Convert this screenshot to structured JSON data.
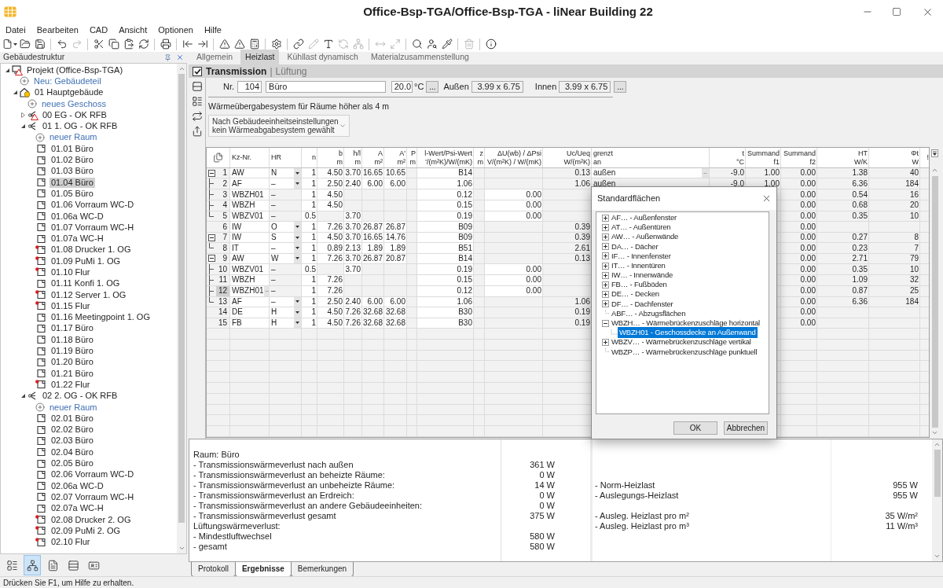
{
  "window": {
    "title": "Office-Bsp-TGA/Office-Bsp-TGA - liNear Building 22"
  },
  "menu": [
    "Datei",
    "Bearbeiten",
    "CAD",
    "Ansicht",
    "Optionen",
    "Hilfe"
  ],
  "toolbar": [
    {
      "kind": "new",
      "disabled": false
    },
    {
      "kind": "open",
      "disabled": false
    },
    {
      "kind": "save",
      "disabled": false
    },
    {
      "kind": "separator"
    },
    {
      "kind": "undo",
      "disabled": false
    },
    {
      "kind": "redo",
      "disabled": true
    },
    {
      "kind": "separator"
    },
    {
      "kind": "cut",
      "disabled": false
    },
    {
      "kind": "copy",
      "disabled": false
    },
    {
      "kind": "paste",
      "disabled": false
    },
    {
      "kind": "sync",
      "disabled": false
    },
    {
      "kind": "separator"
    },
    {
      "kind": "print",
      "disabled": false
    },
    {
      "kind": "separator"
    },
    {
      "kind": "import",
      "disabled": false
    },
    {
      "kind": "export",
      "disabled": false
    },
    {
      "kind": "separator"
    },
    {
      "kind": "warning",
      "disabled": false
    },
    {
      "kind": "warning",
      "disabled": false
    },
    {
      "kind": "calc",
      "disabled": false
    },
    {
      "kind": "separator"
    },
    {
      "kind": "settings",
      "disabled": false
    },
    {
      "kind": "separator"
    },
    {
      "kind": "link",
      "disabled": false
    },
    {
      "kind": "pencil",
      "disabled": true
    },
    {
      "kind": "text",
      "disabled": false
    },
    {
      "kind": "rotate",
      "disabled": true
    },
    {
      "kind": "tree",
      "disabled": true
    },
    {
      "kind": "separator"
    },
    {
      "kind": "measure",
      "disabled": true
    },
    {
      "kind": "resize",
      "disabled": true
    },
    {
      "kind": "separator"
    },
    {
      "kind": "search",
      "disabled": false
    },
    {
      "kind": "find",
      "disabled": false
    },
    {
      "kind": "pick",
      "disabled": false
    },
    {
      "kind": "separator"
    },
    {
      "kind": "delete",
      "disabled": true
    },
    {
      "kind": "separator"
    },
    {
      "kind": "info",
      "disabled": false
    }
  ],
  "sidebar": {
    "title": "Gebäudestruktur",
    "tree": [
      {
        "label": "Projekt (Office-Bsp-TGA)",
        "kind": "project",
        "warning": true,
        "expanded": true,
        "selected": false,
        "children": [
          {
            "label": "Neu: Gebäudeteil",
            "kind": "add",
            "selected": false
          },
          {
            "label": "01 Hauptgebäude",
            "kind": "building",
            "warning": true,
            "expanded": true,
            "selected": false,
            "children": [
              {
                "label": "neues Geschoss",
                "kind": "add",
                "selected": false
              },
              {
                "label": "00 EG - OK RFB",
                "kind": "floor",
                "warning": true,
                "expanded": false,
                "selected": false
              },
              {
                "label": "01 1. OG - OK RFB",
                "kind": "floor",
                "warning": false,
                "expanded": true,
                "selected": false,
                "children": [
                  {
                    "label": "neuer Raum",
                    "kind": "add",
                    "selected": false
                  },
                  {
                    "label": "01.01 Büro",
                    "kind": "room",
                    "marked": false,
                    "selected": false
                  },
                  {
                    "label": "01.02 Büro",
                    "kind": "room",
                    "marked": false,
                    "selected": false
                  },
                  {
                    "label": "01.03 Büro",
                    "kind": "room",
                    "marked": false,
                    "selected": false
                  },
                  {
                    "label": "01.04 Büro",
                    "kind": "room",
                    "marked": false,
                    "selected": true
                  },
                  {
                    "label": "01.05 Büro",
                    "kind": "room",
                    "marked": false,
                    "selected": false
                  },
                  {
                    "label": "01.06 Vorraum WC-D",
                    "kind": "room",
                    "marked": false,
                    "selected": false
                  },
                  {
                    "label": "01.06a WC-D",
                    "kind": "room",
                    "marked": false,
                    "selected": false
                  },
                  {
                    "label": "01.07 Vorraum WC-H",
                    "kind": "room",
                    "marked": false,
                    "selected": false
                  },
                  {
                    "label": "01.07a WC-H",
                    "kind": "room",
                    "marked": false,
                    "selected": false
                  },
                  {
                    "label": "01.08 Drucker 1. OG",
                    "kind": "room",
                    "marked": true,
                    "selected": false
                  },
                  {
                    "label": "01.09 PuMi 1. OG",
                    "kind": "room",
                    "marked": true,
                    "selected": false
                  },
                  {
                    "label": "01.10 Flur",
                    "kind": "room",
                    "marked": true,
                    "selected": false
                  },
                  {
                    "label": "01.11 Konfi 1. OG",
                    "kind": "room",
                    "marked": false,
                    "selected": false
                  },
                  {
                    "label": "01.12 Server 1. OG",
                    "kind": "room",
                    "marked": true,
                    "selected": false
                  },
                  {
                    "label": "01.15 Flur",
                    "kind": "room",
                    "marked": true,
                    "selected": false
                  },
                  {
                    "label": "01.16 Meetingpoint 1. OG",
                    "kind": "room",
                    "marked": false,
                    "selected": false
                  },
                  {
                    "label": "01.17 Büro",
                    "kind": "room",
                    "marked": false,
                    "selected": false
                  },
                  {
                    "label": "01.18 Büro",
                    "kind": "room",
                    "marked": false,
                    "selected": false
                  },
                  {
                    "label": "01.19 Büro",
                    "kind": "room",
                    "marked": false,
                    "selected": false
                  },
                  {
                    "label": "01.20 Büro",
                    "kind": "room",
                    "marked": false,
                    "selected": false
                  },
                  {
                    "label": "01.21 Büro",
                    "kind": "room",
                    "marked": false,
                    "selected": false
                  },
                  {
                    "label": "01.22 Flur",
                    "kind": "room",
                    "marked": true,
                    "selected": false
                  }
                ]
              },
              {
                "label": "02 2. OG - OK RFB",
                "kind": "floor",
                "warning": false,
                "expanded": true,
                "selected": false,
                "children": [
                  {
                    "label": "neuer Raum",
                    "kind": "add",
                    "selected": false
                  },
                  {
                    "label": "02.01 Büro",
                    "kind": "room",
                    "marked": false,
                    "selected": false
                  },
                  {
                    "label": "02.02 Büro",
                    "kind": "room",
                    "marked": false,
                    "selected": false
                  },
                  {
                    "label": "02.03 Büro",
                    "kind": "room",
                    "marked": false,
                    "selected": false
                  },
                  {
                    "label": "02.04 Büro",
                    "kind": "room",
                    "marked": false,
                    "selected": false
                  },
                  {
                    "label": "02.05 Büro",
                    "kind": "room",
                    "marked": false,
                    "selected": false
                  },
                  {
                    "label": "02.06 Vorraum WC-D",
                    "kind": "room",
                    "marked": false,
                    "selected": false
                  },
                  {
                    "label": "02.06a WC-D",
                    "kind": "room",
                    "marked": false,
                    "selected": false
                  },
                  {
                    "label": "02.07 Vorraum WC-H",
                    "kind": "room",
                    "marked": false,
                    "selected": false
                  },
                  {
                    "label": "02.07a WC-H",
                    "kind": "room",
                    "marked": false,
                    "selected": false
                  },
                  {
                    "label": "02.08 Drucker 2. OG",
                    "kind": "room",
                    "marked": true,
                    "selected": false
                  },
                  {
                    "label": "02.09 PuMi 2. OG",
                    "kind": "room",
                    "marked": true,
                    "selected": false
                  },
                  {
                    "label": "02.10 Flur",
                    "kind": "room",
                    "marked": true,
                    "selected": false
                  }
                ]
              }
            ]
          }
        ]
      }
    ],
    "views": [
      {
        "selected": false
      },
      {
        "selected": true
      },
      {
        "selected": false
      },
      {
        "selected": false
      },
      {
        "selected": false
      }
    ]
  },
  "tabs": [
    {
      "label": "Allgemein",
      "selected": false
    },
    {
      "label": "Heizlast",
      "selected": true
    },
    {
      "label": "Kühllast dynamisch",
      "selected": false
    },
    {
      "label": "Materialzusammenstellung",
      "selected": false
    }
  ],
  "section": {
    "checked": true,
    "separator": "|",
    "tabs": [
      {
        "label": "Transmission",
        "selected": true
      },
      {
        "label": "Lüftung",
        "selected": false
      }
    ]
  },
  "form": {
    "nr_label": "Nr.",
    "nr": "104",
    "name": "Büro",
    "temp": "20.0",
    "temp_unit": "°C",
    "temp_button": "...",
    "outer_label": "Außen",
    "outer": "3.99 x 6.75",
    "inner_label": "Innen",
    "inner": "3.99 x 6.75",
    "inner_button": "..."
  },
  "heating_system": {
    "label": "Wärmeübergabesystem für Räume höher als 4 m",
    "lines": [
      "Nach Gebäudeeinheitseinstellungen",
      "kein Wärmeabgabesystem gewählt"
    ]
  },
  "table": {
    "columns": [
      {
        "lines": [
          "Kz-Nr."
        ]
      },
      {
        "lines": [
          "HR"
        ]
      },
      {
        "lines": [
          "n"
        ]
      },
      {
        "lines": [
          "b",
          "m"
        ]
      },
      {
        "lines": [
          "h/l",
          "m"
        ]
      },
      {
        "lines": [
          "A",
          "m²"
        ]
      },
      {
        "lines": [
          "A'",
          "m²"
        ]
      },
      {
        "lines": [
          "P",
          "m"
        ]
      },
      {
        "lines": [
          "l-Wert/Psi-Wert",
          "'/(m²K)/W/(mK)"
        ]
      },
      {
        "lines": [
          "z",
          "m"
        ]
      },
      {
        "lines": [
          "ΔU(wb) / ΔPsi",
          "V/(m²K) / W/(mK)"
        ]
      },
      {
        "lines": [
          "Uc/Ueq",
          "W/(m²K)"
        ]
      },
      {
        "lines": [
          "grenzt",
          "an"
        ]
      },
      {
        "lines": [
          "t",
          "°C"
        ]
      },
      {
        "lines": [
          "Summand",
          "f1"
        ]
      },
      {
        "lines": [
          "Summand",
          "f2"
        ]
      },
      {
        "lines": [
          "HT",
          "W/K"
        ]
      },
      {
        "lines": [
          "Φt",
          "W"
        ]
      },
      {
        "lines": [
          "!"
        ]
      }
    ],
    "rows": [
      {
        "no": "1",
        "selected": false,
        "expanded": true,
        "hr_dropdown": true,
        "grenzt_button": "–",
        "cells": [
          "AW",
          "N",
          "1",
          "4.50",
          "3.70",
          "16.65",
          "10.65",
          null,
          "B14",
          null,
          null,
          "0.13",
          "außen",
          "-9.0",
          "1.00",
          "0.00",
          "1.38",
          "40",
          null
        ],
        "children": [
          {
            "no": "2",
            "selected": false,
            "hr_dropdown": true,
            "cells": [
              "AF",
              "–",
              "1",
              "2.50",
              "2.40",
              "6.00",
              "6.00",
              null,
              "1.06",
              null,
              null,
              "1.06",
              "außen",
              "-9.0",
              "1.00",
              "0.00",
              "6.36",
              "184",
              null
            ]
          },
          {
            "no": "3",
            "selected": false,
            "hr_dropdown": false,
            "cells": [
              "WBZH01",
              "–",
              "1",
              "4.50",
              null,
              null,
              null,
              null,
              "0.12",
              null,
              "0.00",
              null,
              null,
              null,
              null,
              "0.00",
              "0.54",
              "16",
              null
            ]
          },
          {
            "no": "4",
            "selected": false,
            "hr_dropdown": false,
            "cells": [
              "WBZH",
              "–",
              "1",
              "4.50",
              null,
              null,
              null,
              null,
              "0.15",
              null,
              "0.00",
              null,
              null,
              null,
              null,
              "0.00",
              "0.68",
              "20",
              null
            ]
          },
          {
            "no": "5",
            "selected": false,
            "hr_dropdown": false,
            "cells": [
              "WBZV01",
              "–",
              "0.5",
              null,
              "3.70",
              null,
              null,
              null,
              "0.19",
              null,
              "0.00",
              null,
              null,
              null,
              null,
              "0.00",
              "0.35",
              "10",
              null
            ]
          }
        ]
      },
      {
        "no": "6",
        "selected": false,
        "hr_dropdown": true,
        "cells": [
          "IW",
          "O",
          "1",
          "7.26",
          "3.70",
          "26.87",
          "26.87",
          null,
          "B09",
          null,
          null,
          "0.39",
          null,
          null,
          null,
          "0.00",
          null,
          null,
          null
        ]
      },
      {
        "no": "7",
        "selected": false,
        "expanded": true,
        "hr_dropdown": true,
        "cells": [
          "IW",
          "S",
          "1",
          "4.50",
          "3.70",
          "16.65",
          "14.76",
          null,
          "B09",
          null,
          null,
          "0.39",
          null,
          null,
          null,
          "0.00",
          "0.27",
          "8",
          null
        ],
        "children": [
          {
            "no": "8",
            "selected": false,
            "hr_dropdown": true,
            "cells": [
              "IT",
              "–",
              "1",
              "0.89",
              "2.13",
              "1.89",
              "1.89",
              null,
              "B51",
              null,
              null,
              "2.61",
              null,
              null,
              null,
              "0.00",
              "0.23",
              "7",
              null
            ]
          }
        ]
      },
      {
        "no": "9",
        "selected": false,
        "expanded": true,
        "hr_dropdown": true,
        "cells": [
          "AW",
          "W",
          "1",
          "7.26",
          "3.70",
          "26.87",
          "20.87",
          null,
          "B14",
          null,
          null,
          "0.13",
          null,
          null,
          null,
          "0.00",
          "2.71",
          "79",
          null
        ],
        "children": [
          {
            "no": "10",
            "selected": false,
            "hr_dropdown": false,
            "cells": [
              "WBZV01",
              "–",
              "0.5",
              null,
              "3.70",
              null,
              null,
              null,
              "0.19",
              null,
              "0.00",
              null,
              null,
              null,
              null,
              "0.00",
              "0.35",
              "10",
              null
            ]
          },
          {
            "no": "11",
            "selected": false,
            "hr_dropdown": false,
            "cells": [
              "WBZH",
              "–",
              "1",
              "7.26",
              null,
              null,
              null,
              null,
              "0.15",
              null,
              "0.00",
              null,
              null,
              null,
              null,
              "0.00",
              "1.09",
              "32",
              null
            ]
          },
          {
            "no": "12",
            "selected": true,
            "hr_dropdown": false,
            "kz_button": "–",
            "cells": [
              "WBZH01",
              "–",
              "1",
              "7.26",
              null,
              null,
              null,
              null,
              "0.12",
              null,
              "0.00",
              null,
              null,
              null,
              null,
              "0.00",
              "0.87",
              "25",
              null
            ]
          },
          {
            "no": "13",
            "selected": false,
            "hr_dropdown": true,
            "cells": [
              "AF",
              "–",
              "1",
              "2.50",
              "2.40",
              "6.00",
              "6.00",
              null,
              "1.06",
              null,
              null,
              "1.06",
              null,
              null,
              null,
              "0.00",
              "6.36",
              "184",
              null
            ]
          }
        ]
      },
      {
        "no": "14",
        "selected": false,
        "hr_dropdown": true,
        "cells": [
          "DE",
          "H",
          "1",
          "4.50",
          "7.26",
          "32.68",
          "32.68",
          null,
          "B30",
          null,
          null,
          "0.19",
          null,
          null,
          null,
          "0.00",
          null,
          null,
          null
        ]
      },
      {
        "no": "15",
        "selected": false,
        "hr_dropdown": true,
        "cells": [
          "FB",
          "H",
          "1",
          "4.50",
          "7.26",
          "32.68",
          "32.68",
          null,
          "B30",
          null,
          null,
          "0.19",
          null,
          null,
          null,
          "0.00",
          null,
          null,
          null
        ]
      }
    ]
  },
  "dialog": {
    "title": "Standardflächen",
    "items": [
      {
        "label": "AF… - Außenfenster",
        "expanded": false,
        "selected": false
      },
      {
        "label": "AT… - Außentüren",
        "expanded": false,
        "selected": false
      },
      {
        "label": "AW… - Außenwände",
        "expanded": false,
        "selected": false
      },
      {
        "label": "DA… - Dächer",
        "expanded": false,
        "selected": false
      },
      {
        "label": "IF… - Innenfenster",
        "expanded": false,
        "selected": false
      },
      {
        "label": "IT… - Innentüren",
        "expanded": false,
        "selected": false
      },
      {
        "label": "IW… - Innenwände",
        "expanded": false,
        "selected": false
      },
      {
        "label": "FB… - Fußböden",
        "expanded": false,
        "selected": false
      },
      {
        "label": "DE… - Decken",
        "expanded": false,
        "selected": false
      },
      {
        "label": "DF… - Dachfenster",
        "expanded": false,
        "selected": false
      },
      {
        "label": "ABF… - Abzugsflächen",
        "selected": false
      },
      {
        "label": "WBZH… - Wärmebrückenzuschläge horizontal",
        "expanded": true,
        "selected": false,
        "children": [
          {
            "label": "WBZH01 - Geschossdecke an Außenwand",
            "selected": true
          }
        ]
      },
      {
        "label": "WBZV… - Wärmebrückenzuschläge vertikal",
        "expanded": false,
        "selected": false
      },
      {
        "label": "WBZP… - Wärmebrückenzuschläge punktuell",
        "selected": false
      }
    ],
    "buttons": [
      "OK",
      "Abbrechen"
    ]
  },
  "results": {
    "left": [
      {
        "label": "Raum: Büro"
      },
      {
        "label": "- Transmissionswärmeverlust nach außen",
        "value": "361 W"
      },
      {
        "label": "- Transmissionswärmeverlust an beheizte Räume:",
        "value": "0 W"
      },
      {
        "label": "- Transmissionswärmeverlust an unbeheizte Räume:",
        "value": "14 W"
      },
      {
        "label": "- Transmissionswärmeverlust an Erdreich:",
        "value": "0 W"
      },
      {
        "label": "- Transmissionswärmeverlust an andere Gebäudeeinheiten:",
        "value": "0 W"
      },
      {
        "label": "- Transmissionswärmeverlust gesamt",
        "value": "375 W"
      },
      {
        "label": "Lüftungswärmeverlust:"
      },
      {
        "label": "- Mindestluftwechsel",
        "value": "580 W"
      },
      {
        "label": "- gesamt",
        "value": "580 W"
      }
    ],
    "right_groups": [
      [
        {
          "label": "- Norm-Heizlast",
          "value": "955 W"
        },
        {
          "label": "- Auslegungs-Heizlast",
          "value": "955 W"
        }
      ],
      [
        {
          "label": "- Ausleg. Heizlast pro m²",
          "value": "35 W/m²"
        },
        {
          "label": "- Ausleg. Heizlast pro m³",
          "value": "11 W/m³"
        }
      ]
    ]
  },
  "bottom_tabs": [
    {
      "label": "Protokoll",
      "selected": false
    },
    {
      "label": "Ergebnisse",
      "selected": true
    },
    {
      "label": "Bemerkungen",
      "selected": false
    }
  ],
  "status_bar": "Drücken Sie F1, um Hilfe zu erhalten."
}
